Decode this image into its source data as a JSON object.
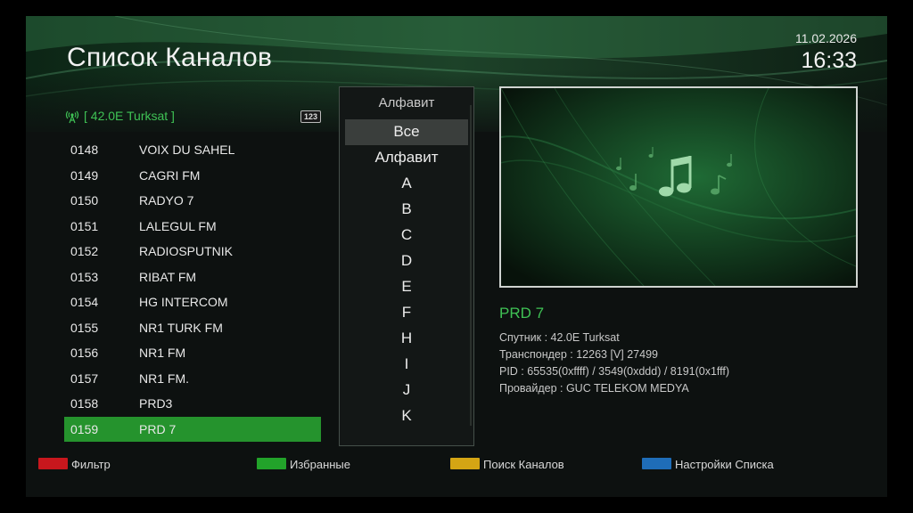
{
  "header": {
    "title": "Список Каналов",
    "date": "11.02.2026",
    "time": "16:33"
  },
  "satellite": {
    "label": "[ 42.0E Turksat ]",
    "badge": "123",
    "icon": "satellite-dish-icon"
  },
  "channels": [
    {
      "num": "0148",
      "name": "VOIX DU SAHEL"
    },
    {
      "num": "0149",
      "name": "CAGRI FM"
    },
    {
      "num": "0150",
      "name": "RADYO 7"
    },
    {
      "num": "0151",
      "name": "LALEGUL FM"
    },
    {
      "num": "0152",
      "name": "RADIOSPUTNIK"
    },
    {
      "num": "0153",
      "name": "RIBAT FM"
    },
    {
      "num": "0154",
      "name": "HG INTERCOM"
    },
    {
      "num": "0155",
      "name": "NR1 TURK FM"
    },
    {
      "num": "0156",
      "name": "NR1 FM"
    },
    {
      "num": "0157",
      "name": "NR1 FM."
    },
    {
      "num": "0158",
      "name": "PRD3"
    },
    {
      "num": "0159",
      "name": "PRD 7",
      "selected": true
    }
  ],
  "sort_menu": {
    "title": "Алфавит",
    "options": [
      "Все",
      "Алфавит",
      "A",
      "B",
      "C",
      "D",
      "E",
      "F",
      "H",
      "I",
      "J",
      "K"
    ],
    "selected": "Все"
  },
  "preview": {
    "icon": "music-note-icon"
  },
  "channel_info": {
    "name": "PRD 7",
    "satellite": "Спутник : 42.0E Turksat",
    "transponder": "Транспондер : 12263 [V] 27499",
    "pid": "PID : 65535(0xffff) / 3549(0xddd) / 8191(0x1fff)",
    "provider": "Провайдер : GUC TELEKOM MEDYA"
  },
  "footer": {
    "red": {
      "label": "Фильтр",
      "color": "#c8171d"
    },
    "green": {
      "label": "Избранные",
      "color": "#22a32a"
    },
    "yellow": {
      "label": "Поиск Каналов",
      "color": "#d4a514"
    },
    "blue": {
      "label": "Настройки Списка",
      "color": "#1f6db8"
    }
  },
  "colors": {
    "accent": "#3fc255",
    "selection": "#25932d"
  }
}
